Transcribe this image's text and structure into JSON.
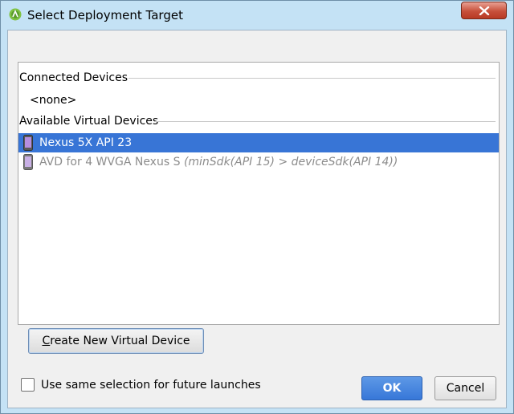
{
  "window": {
    "title": "Select Deployment Target",
    "app_icon": "android-studio-icon",
    "close_icon": "close-icon"
  },
  "sections": {
    "connected": {
      "header": "Connected Devices",
      "empty_label": "<none>"
    },
    "available": {
      "header": "Available Virtual Devices",
      "devices": [
        {
          "name": "Nexus 5X API 23",
          "note": "",
          "selected": true,
          "enabled": true,
          "icon": "phone-icon"
        },
        {
          "name": "AVD for 4 WVGA Nexus S",
          "note": "(minSdk(API 15) > deviceSdk(API 14))",
          "selected": false,
          "enabled": false,
          "icon": "phone-icon"
        }
      ]
    }
  },
  "create_button": {
    "mnemonic": "C",
    "rest": "reate New Virtual Device"
  },
  "checkbox": {
    "label": "Use same selection for future launches",
    "checked": false
  },
  "buttons": {
    "ok": "OK",
    "cancel": "Cancel"
  },
  "colors": {
    "title_bar": "#c4e2f5",
    "selection": "#3875d6",
    "ok_button": "#3777d8",
    "disabled_text": "#8c8c8c"
  }
}
